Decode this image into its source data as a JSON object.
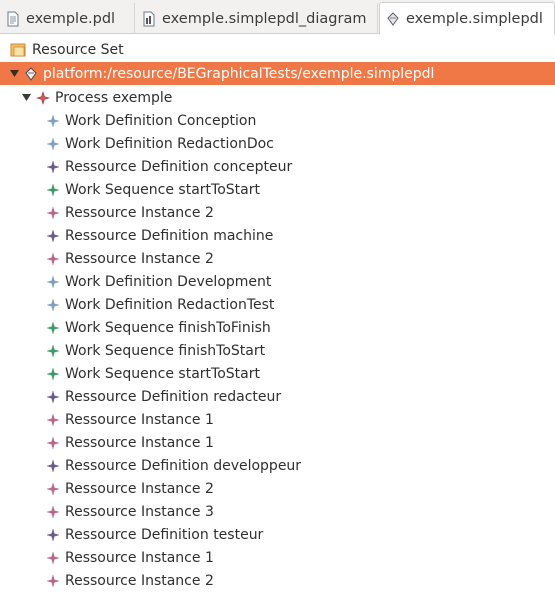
{
  "tabs": [
    {
      "label": "exemple.pdl",
      "active": false
    },
    {
      "label": "exemple.simplepdl_diagram",
      "active": false
    },
    {
      "label": "exemple.simplepdl",
      "active": true
    }
  ],
  "tree": {
    "root_label": "Resource Set",
    "resource_label": "platform:/resource/BEGraphicalTests/exemple.simplepdl",
    "process_label": "Process exemple",
    "items": [
      {
        "label": "Work Definition Conception",
        "kind": "work-definition"
      },
      {
        "label": "Work Definition RedactionDoc",
        "kind": "work-definition"
      },
      {
        "label": "Ressource Definition concepteur",
        "kind": "ressource-definition"
      },
      {
        "label": "Work Sequence startToStart",
        "kind": "work-sequence"
      },
      {
        "label": "Ressource Instance 2",
        "kind": "ressource-instance"
      },
      {
        "label": "Ressource Definition machine",
        "kind": "ressource-definition"
      },
      {
        "label": "Ressource Instance 2",
        "kind": "ressource-instance"
      },
      {
        "label": "Work Definition Development",
        "kind": "work-definition"
      },
      {
        "label": "Work Definition RedactionTest",
        "kind": "work-definition"
      },
      {
        "label": "Work Sequence finishToFinish",
        "kind": "work-sequence"
      },
      {
        "label": "Work Sequence finishToStart",
        "kind": "work-sequence"
      },
      {
        "label": "Work Sequence startToStart",
        "kind": "work-sequence"
      },
      {
        "label": "Ressource Definition redacteur",
        "kind": "ressource-definition"
      },
      {
        "label": "Ressource Instance 1",
        "kind": "ressource-instance"
      },
      {
        "label": "Ressource Instance 1",
        "kind": "ressource-instance"
      },
      {
        "label": "Ressource Definition developpeur",
        "kind": "ressource-definition"
      },
      {
        "label": "Ressource Instance 2",
        "kind": "ressource-instance"
      },
      {
        "label": "Ressource Instance 3",
        "kind": "ressource-instance"
      },
      {
        "label": "Ressource Definition testeur",
        "kind": "ressource-definition"
      },
      {
        "label": "Ressource Instance 1",
        "kind": "ressource-instance"
      },
      {
        "label": "Ressource Instance 2",
        "kind": "ressource-instance"
      }
    ]
  },
  "colors": {
    "selection": "#f07746",
    "work-definition": "#7f9fbf",
    "ressource-definition": "#6a5a8c",
    "work-sequence": "#3f9a6a",
    "ressource-instance": "#b8688a",
    "process": "#c24a4a"
  }
}
